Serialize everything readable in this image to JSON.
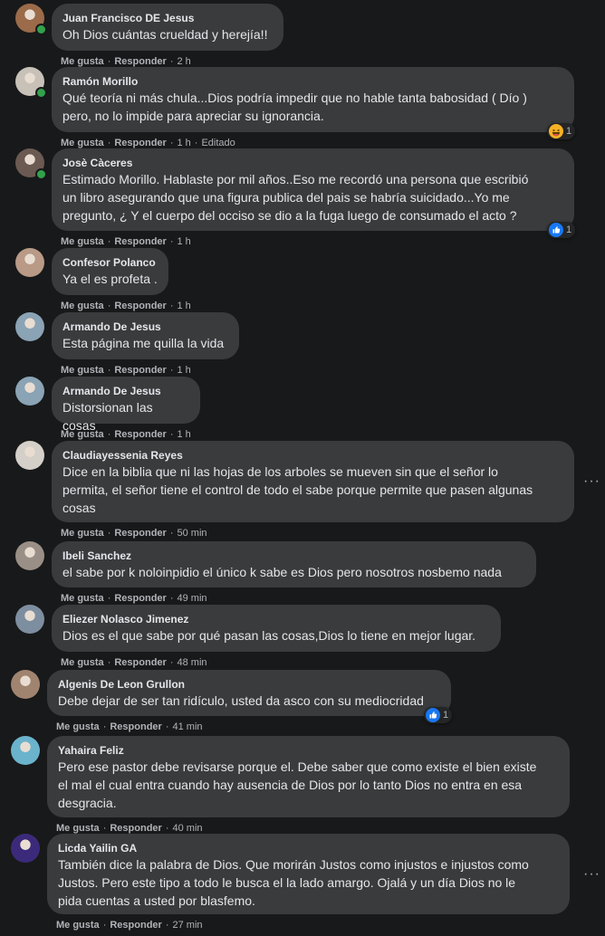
{
  "common": {
    "like": "Me gusta",
    "reply": "Responder",
    "sep": "·"
  },
  "comments": [
    {
      "name": "Juan Francisco DE Jesus",
      "text": "Oh Dios cuántas crueldad y herejía!!",
      "time": "2 h"
    },
    {
      "name": "Ramón Morillo",
      "text": "Qué teoría ni más chula...Dios podría impedir que no hable tanta babosidad ( Dío )\npero, no lo impide para apreciar su ignorancia.",
      "time": "1 h",
      "edited": "Editado",
      "reaction": {
        "icon": "haha-icon",
        "count": "1"
      }
    },
    {
      "name": "Josè Càceres",
      "text": "Estimado Morillo. Hablaste por mil años..Eso me recordó una persona que escribió\nun libro asegurando que una figura publica del pais se habría suicidado...Yo me\npregunto, ¿ Y el cuerpo del occiso se dio a la fuga luego de consumado el acto ?",
      "time": "1 h",
      "reaction": {
        "icon": "like-icon",
        "count": "1"
      }
    },
    {
      "name": "Confesor Polanco",
      "text": "Ya el es profeta .",
      "time": "1 h"
    },
    {
      "name": "Armando De Jesus",
      "text": "Esta página me quilla la vida",
      "time": "1 h"
    },
    {
      "name": "Armando De Jesus",
      "text": "Distorsionan las cosas",
      "time": "1 h"
    },
    {
      "name": "Claudiayessenia Reyes",
      "text": "Dice en la biblia que ni las hojas de los arboles se mueven sin que el señor lo\npermita, el señor tiene el control de todo el sabe porque permite que pasen algunas\ncosas",
      "time": "50 min"
    },
    {
      "name": "Ibeli Sanchez",
      "text": "el sabe por k noloinpidio el único k sabe es Dios pero nosotros nosbemo nada",
      "time": "49 min"
    },
    {
      "name": "Eliezer Nolasco Jimenez",
      "text": "Dios es el que sabe por qué pasan las cosas,Dios lo tiene en mejor lugar.",
      "time": "48 min"
    },
    {
      "name": "Algenis De Leon Grullon",
      "text": "Debe dejar de ser tan ridículo, usted da asco con su mediocridad",
      "time": "41 min",
      "reaction": {
        "icon": "like-icon",
        "count": "1"
      }
    },
    {
      "name": "Yahaira Feliz",
      "text": "Pero ese pastor debe revisarse porque el. Debe saber que como existe el bien existe\nel mal el cual entra cuando hay ausencia de Dios por lo tanto Dios no entra en esa\ndesgracia.",
      "time": "40 min"
    },
    {
      "name": "Licda Yailin GA",
      "text": "También dice la palabra de Dios. Que morirán Justos como injustos e injustos como\nJustos. Pero este tipo a todo le busca el la lado amargo. Ojalá y un día Dios no le\npida cuentas a usted por blasfemo.",
      "time": "27 min"
    }
  ],
  "more_label": "···"
}
